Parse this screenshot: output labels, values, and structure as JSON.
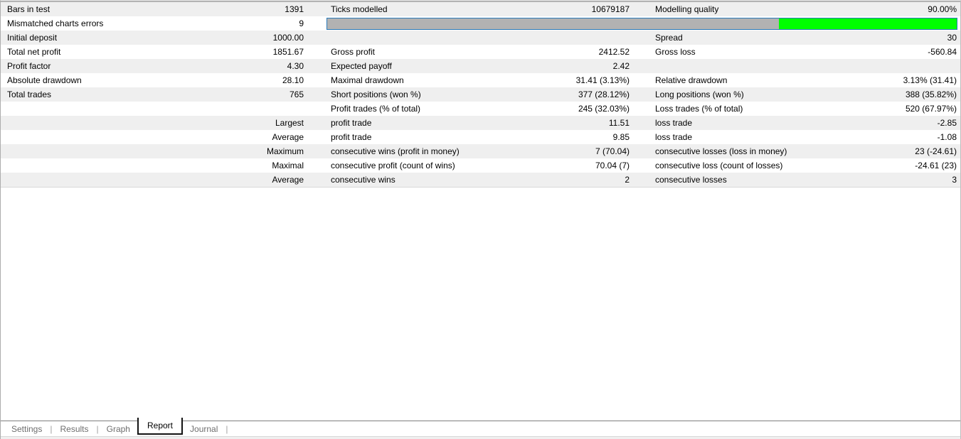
{
  "colors": {
    "bar_border": "#2b7ab9",
    "bar_gray": "#b2b2b2",
    "bar_green": "#00ff00",
    "row_stripe": "#efefef",
    "tab_inactive_text": "#6e6e6e",
    "tab_active_text": "#000000"
  },
  "progress_bar": {
    "gray_percent": 71.8,
    "green_percent": 28.2,
    "represents": "Modelling quality 90.00%"
  },
  "report_rows": [
    {
      "c1l": "Bars in test",
      "c1v": "1391",
      "c2l": "Ticks modelled",
      "c2v": "10679187",
      "c3l": "Modelling quality",
      "c3v": "90.00%"
    },
    {
      "c1l": "Mismatched charts errors",
      "c1v": "9"
    },
    {
      "c1l": "Initial deposit",
      "c1v": "1000.00",
      "c3l": "Spread",
      "c3v": "30"
    },
    {
      "c1l": "Total net profit",
      "c1v": "1851.67",
      "c2l": "Gross profit",
      "c2v": "2412.52",
      "c3l": "Gross loss",
      "c3v": "-560.84"
    },
    {
      "c1l": "Profit factor",
      "c1v": "4.30",
      "c2l": "Expected payoff",
      "c2v": "2.42"
    },
    {
      "c1l": "Absolute drawdown",
      "c1v": "28.10",
      "c2l": "Maximal drawdown",
      "c2v": "31.41 (3.13%)",
      "c3l": "Relative drawdown",
      "c3v": "3.13% (31.41)"
    },
    {
      "c1l": "Total trades",
      "c1v": "765",
      "c2l": "Short positions (won %)",
      "c2v": "377 (28.12%)",
      "c3l": "Long positions (won %)",
      "c3v": "388 (35.82%)"
    },
    {
      "c2l": "Profit trades (% of total)",
      "c2v": "245 (32.03%)",
      "c3l": "Loss trades (% of total)",
      "c3v": "520 (67.97%)"
    },
    {
      "c1v": "Largest",
      "c2l": "profit trade",
      "c2v": "11.51",
      "c3l": "loss trade",
      "c3v": "-2.85"
    },
    {
      "c1v": "Average",
      "c2l": "profit trade",
      "c2v": "9.85",
      "c3l": "loss trade",
      "c3v": "-1.08"
    },
    {
      "c1v": "Maximum",
      "c2l": "consecutive wins (profit in money)",
      "c2v": "7 (70.04)",
      "c3l": "consecutive losses (loss in money)",
      "c3v": "23 (-24.61)"
    },
    {
      "c1v": "Maximal",
      "c2l": "consecutive profit (count of wins)",
      "c2v": "70.04 (7)",
      "c3l": "consecutive loss (count of losses)",
      "c3v": "-24.61 (23)"
    },
    {
      "c1v": "Average",
      "c2l": "consecutive wins",
      "c2v": "2",
      "c3l": "consecutive losses",
      "c3v": "3"
    }
  ],
  "tabs": [
    {
      "label": "Settings",
      "active": false
    },
    {
      "label": "Results",
      "active": false
    },
    {
      "label": "Graph",
      "active": false
    },
    {
      "label": "Report",
      "active": true
    },
    {
      "label": "Journal",
      "active": false
    }
  ]
}
